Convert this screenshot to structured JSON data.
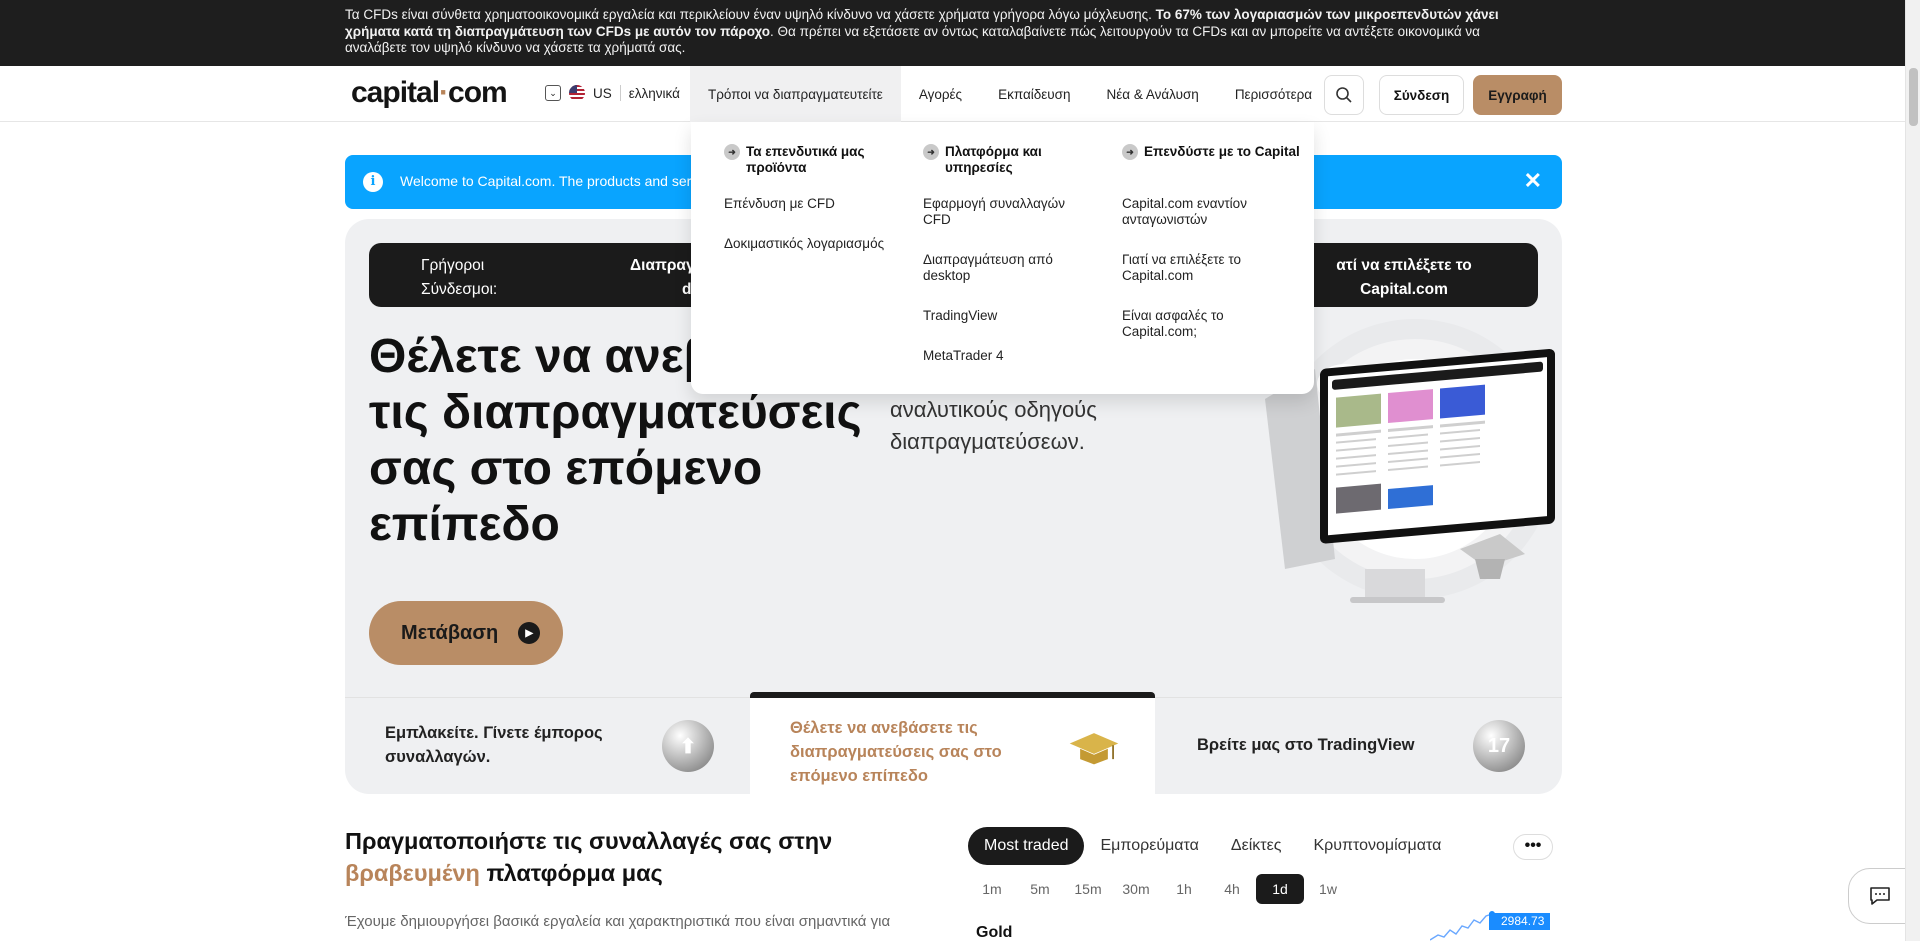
{
  "risk_banner": {
    "text_1": "Τα CFDs είναι σύνθετα χρηματοοικονομικά εργαλεία και περικλείουν έναν υψηλό κίνδυνο να χάσετε χρήματα γρήγορα λόγω μόχλευσης. ",
    "text_bold": "Το 67% των λογαριασμών των μικροεπενδυτών χάνει χρήματα κατά τη διαπραγμάτευση των CFDs με αυτόν τον πάροχο",
    "text_2": ". Θα πρέπει να εξετάσετε αν όντως καταλαβαίνετε πώς λειτουργούν τα CFDs και αν μπορείτε να αντέξετε οικονομικά να αναλάβετε τον υψηλό κίνδυνο να χάσετε τα χρήματά σας."
  },
  "header": {
    "logo_a": "capital",
    "logo_dot": "·",
    "logo_b": "com",
    "country": "US",
    "language": "ελληνικά",
    "nav": [
      {
        "label": "Τρόποι να διαπραγματευτείτε"
      },
      {
        "label": "Αγορές"
      },
      {
        "label": "Εκπαίδευση"
      },
      {
        "label": "Νέα & Ανάλυση"
      },
      {
        "label": "Περισσότερα"
      }
    ],
    "login": "Σύνδεση",
    "signup": "Εγγραφή"
  },
  "dropdown": {
    "columns": [
      {
        "title": "Τα επενδυτικά μας προϊόντα",
        "links": [
          "Επένδυση με CFD",
          "Δοκιμαστικός λογαριασμός"
        ]
      },
      {
        "title": "Πλατφόρμα και υπηρεσίες",
        "links": [
          "Εφαρμογή συναλλαγών CFD",
          "Διαπραγμάτευση από desktop",
          "TradingView",
          "MetaTrader 4"
        ]
      },
      {
        "title": "Επενδύστε με το Capital",
        "links": [
          "Capital.com εναντίον ανταγωνιστών",
          "Γιατί να επιλέξετε το Capital.com",
          "Είναι ασφαλές το Capital.com;"
        ]
      }
    ]
  },
  "welcome": {
    "text": "Welcome to Capital.com. The products and servi"
  },
  "quick_links": {
    "label": "Γρήγοροι Σύνδεσμοι:",
    "link_1_line_1": "Διαπραγ",
    "link_1_line_2": "de",
    "link_2": "Γιατί να επιλέξετε το Capital.com",
    "link_2_visible": "ατί να επιλέξετε το Capital.com"
  },
  "hero": {
    "title": "Θέλετε να ανεβ τις διαπραγματεύσεις σας στο επόμενο επίπεδο",
    "title_line_1": "Θέλετε να ανεβ",
    "title_line_2": "τις διαπραγματεύσεις",
    "title_line_3": "σας στο επόμενο",
    "title_line_4": "επίπεδο",
    "subtitle_line_1": "αναλυτικούς οδηγούς",
    "subtitle_line_2": "διαπραγματεύσεων.",
    "button": "Μετάβαση"
  },
  "tiles": [
    {
      "text": "Εμπλακείτε. Γίνετε έμπορος συναλλαγών."
    },
    {
      "text": "Θέλετε να ανεβάσετε τις διαπραγματεύσεις σας στο επόμενο επίπεδο"
    },
    {
      "text_a": "Βρείτε μας στο ",
      "text_b": "TradingView"
    }
  ],
  "platform_section": {
    "title_1": "Πραγματοποιήστε τις συναλλαγές σας στην ",
    "title_accent": "βραβευμένη",
    "title_2": " πλατφόρμα μας",
    "text": "Έχουμε δημιουργήσει βασικά εργαλεία και χαρακτηριστικά που είναι σημαντικά για"
  },
  "markets": {
    "tabs": [
      "Most traded",
      "Εμπορεύματα",
      "Δείκτες",
      "Κρυπτονομίσματα"
    ],
    "timeframes": [
      "1m",
      "5m",
      "15m",
      "30m",
      "1h",
      "4h",
      "1d",
      "1w"
    ],
    "active_timeframe": "1d",
    "instrument": "Gold",
    "price": "2984.73"
  },
  "colors": {
    "accent": "#b98d66",
    "banner_bg": "#1e1e1e",
    "welcome_bg": "#09a4ff",
    "hero_bg": "#eff0f2"
  }
}
